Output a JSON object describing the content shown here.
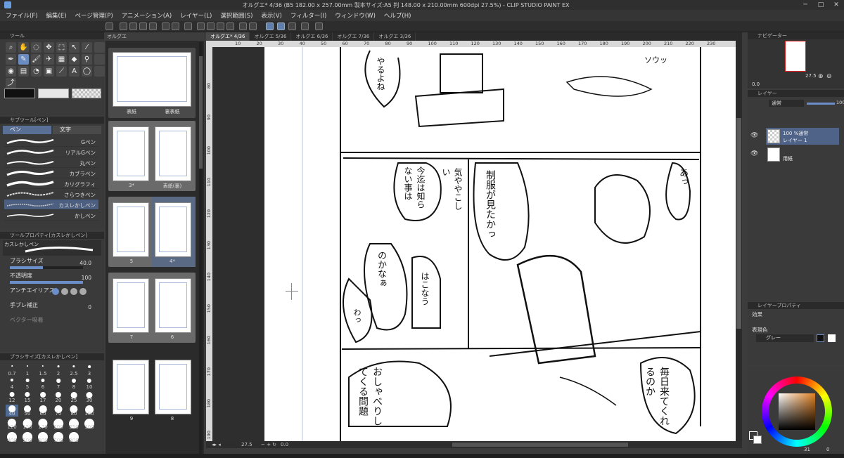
{
  "window": {
    "title": "オルグエ* 4/36 (B5 182.00 x 257.00mm 製本サイズ:A5 判 148.00 x 210.00mm 600dpi 27.5%) - CLIP STUDIO PAINT EX"
  },
  "menu": [
    "ファイル(F)",
    "編集(E)",
    "ページ管理(P)",
    "アニメーション(A)",
    "レイヤー(L)",
    "選択範囲(S)",
    "表示(V)",
    "フィルター(I)",
    "ウィンドウ(W)",
    "ヘルプ(H)"
  ],
  "tool_panel": {
    "title": "ツール"
  },
  "sub_tool": {
    "title": "サブツール[ペン]",
    "tab_pen": "ペン",
    "tab_text": "文字",
    "brushes": [
      "Gペン",
      "リアルGペン",
      "丸ペン",
      "カブラペン",
      "カリグラフィ",
      "さらつきペン",
      "カスレかしペン",
      "かしペン"
    ],
    "selected": "カスレかしペン"
  },
  "tool_property": {
    "title": "ツールプロパティ[カスレかしペン]",
    "brush_name": "カスレかしペン",
    "brush_size_label": "ブラシサイズ",
    "brush_size": "40.0",
    "opacity_label": "不透明度",
    "opacity": "100",
    "antialias_label": "アンチエイリアス",
    "stabilize_label": "手ブレ補正",
    "stabilize": "0",
    "vector_label": "ベクター吸着"
  },
  "brush_size_panel": {
    "title": "ブラシサイズ[カスレかしペン]",
    "sizes": [
      "0.7",
      "1",
      "1.5",
      "2",
      "2.5",
      "3",
      "4",
      "5",
      "6",
      "7",
      "8",
      "10",
      "12",
      "15",
      "17",
      "20",
      "25",
      "30",
      "40",
      "50",
      "60",
      "70",
      "80",
      "100",
      "120",
      "150",
      "170",
      "200",
      "250",
      "300",
      "400",
      "500",
      "600",
      "700",
      "800"
    ],
    "selected": "40"
  },
  "pages": {
    "tab": "オルグエ",
    "spreads": [
      {
        "left": "表紙",
        "right": "裏表紙"
      },
      {
        "left": "3*",
        "right": "表紙(裏)"
      },
      {
        "left": "5",
        "right": "4*"
      },
      {
        "left": "7",
        "right": "6"
      },
      {
        "left": "9",
        "right": "8"
      }
    ]
  },
  "doc_tabs": [
    "オルグエ*",
    "4/36",
    "オルグエ",
    "5/36",
    "オルグエ",
    "6/36",
    "オルグエ",
    "7/36",
    "オルグエ",
    "3/36"
  ],
  "ruler_h": [
    "10",
    "20",
    "30",
    "40",
    "50",
    "60",
    "70",
    "80",
    "90",
    "100",
    "110",
    "120",
    "130",
    "140",
    "150",
    "160",
    "170",
    "180",
    "190",
    "200",
    "210",
    "220",
    "230"
  ],
  "ruler_v": [
    "80",
    "90",
    "100",
    "110",
    "120",
    "130",
    "140",
    "150",
    "160",
    "170",
    "180",
    "190"
  ],
  "canvas_footer": {
    "zoom": "27.5",
    "angle": "0.0"
  },
  "canvas_text": {
    "b1": "やるよね",
    "b2": "ソウッ",
    "b3": "今迄は知らない事は",
    "b4": "気ややこしい",
    "b5": "制服が見たかっ",
    "b6": "あっ",
    "b7": "のかなぁ",
    "b8": "はこなう",
    "b9": "わっ",
    "b10": "おしゃべりしてくる問題",
    "b11": "毎日来てくれるのか"
  },
  "navigator": {
    "title": "ナビゲーター",
    "zoom": "27.5",
    "angle": "0.0"
  },
  "layers": {
    "title": "レイヤー",
    "blend": "通常",
    "opacity": "100",
    "items": [
      {
        "name1": "100 %通常",
        "name2": "レイヤー 1"
      },
      {
        "name1": "",
        "name2": "用紙"
      }
    ]
  },
  "layer_property": {
    "title": "レイヤープロパティ",
    "effect": "効果",
    "express_color": "表現色",
    "color_value": "グレー"
  },
  "color_panel": {
    "main": "#111111",
    "sub": "#ffffff",
    "num1": "31",
    "num2": "0"
  },
  "colors": {
    "accent": "#5f7fae",
    "paper": "#ffffff",
    "panel": "#3a3a3a"
  }
}
